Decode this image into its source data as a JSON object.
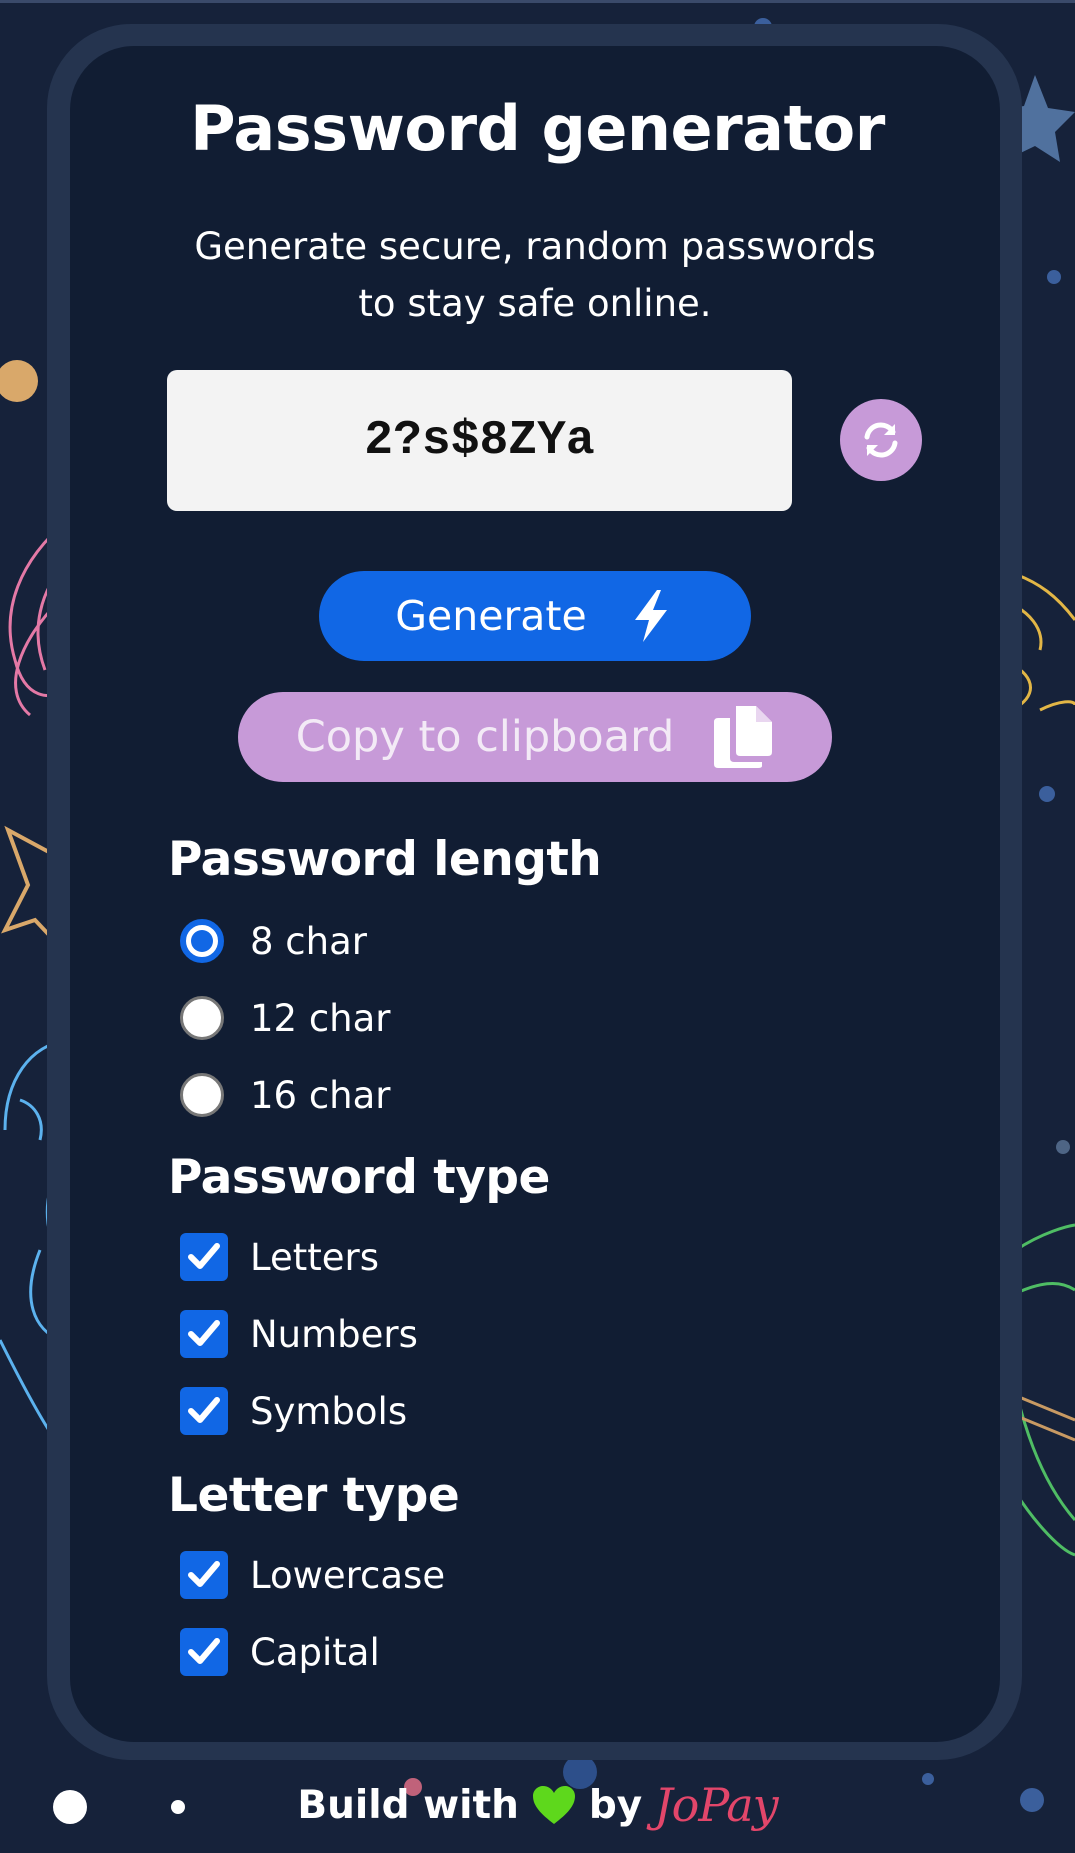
{
  "app": {
    "title": "Password generator",
    "subtitle_line1": "Generate secure, random passwords",
    "subtitle_line2": "to stay safe online."
  },
  "password": {
    "value": "2?s$8ZYa"
  },
  "buttons": {
    "refresh_icon": "refresh-icon",
    "generate_label": "Generate",
    "generate_icon": "bolt-icon",
    "copy_label": "Copy to clipboard",
    "copy_icon": "copy-icon"
  },
  "length": {
    "title": "Password length",
    "options": [
      {
        "label": "8 char",
        "selected": true
      },
      {
        "label": "12 char",
        "selected": false
      },
      {
        "label": "16 char",
        "selected": false
      }
    ]
  },
  "type": {
    "title": "Password type",
    "options": [
      {
        "label": "Letters",
        "checked": true
      },
      {
        "label": "Numbers",
        "checked": true
      },
      {
        "label": "Symbols",
        "checked": true
      }
    ]
  },
  "letter_type": {
    "title": "Letter type",
    "options": [
      {
        "label": "Lowercase",
        "checked": true
      },
      {
        "label": "Capital",
        "checked": true
      }
    ]
  },
  "footer": {
    "build_with": "Build with",
    "heart_icon": "heart-icon",
    "by": "by",
    "brand": "JoPay"
  },
  "colors": {
    "background": "#16223a",
    "card": "#111d33",
    "primary": "#1167e5",
    "accent": "#c79ad8",
    "brand": "#e2466a",
    "heart": "#5ed81c"
  }
}
